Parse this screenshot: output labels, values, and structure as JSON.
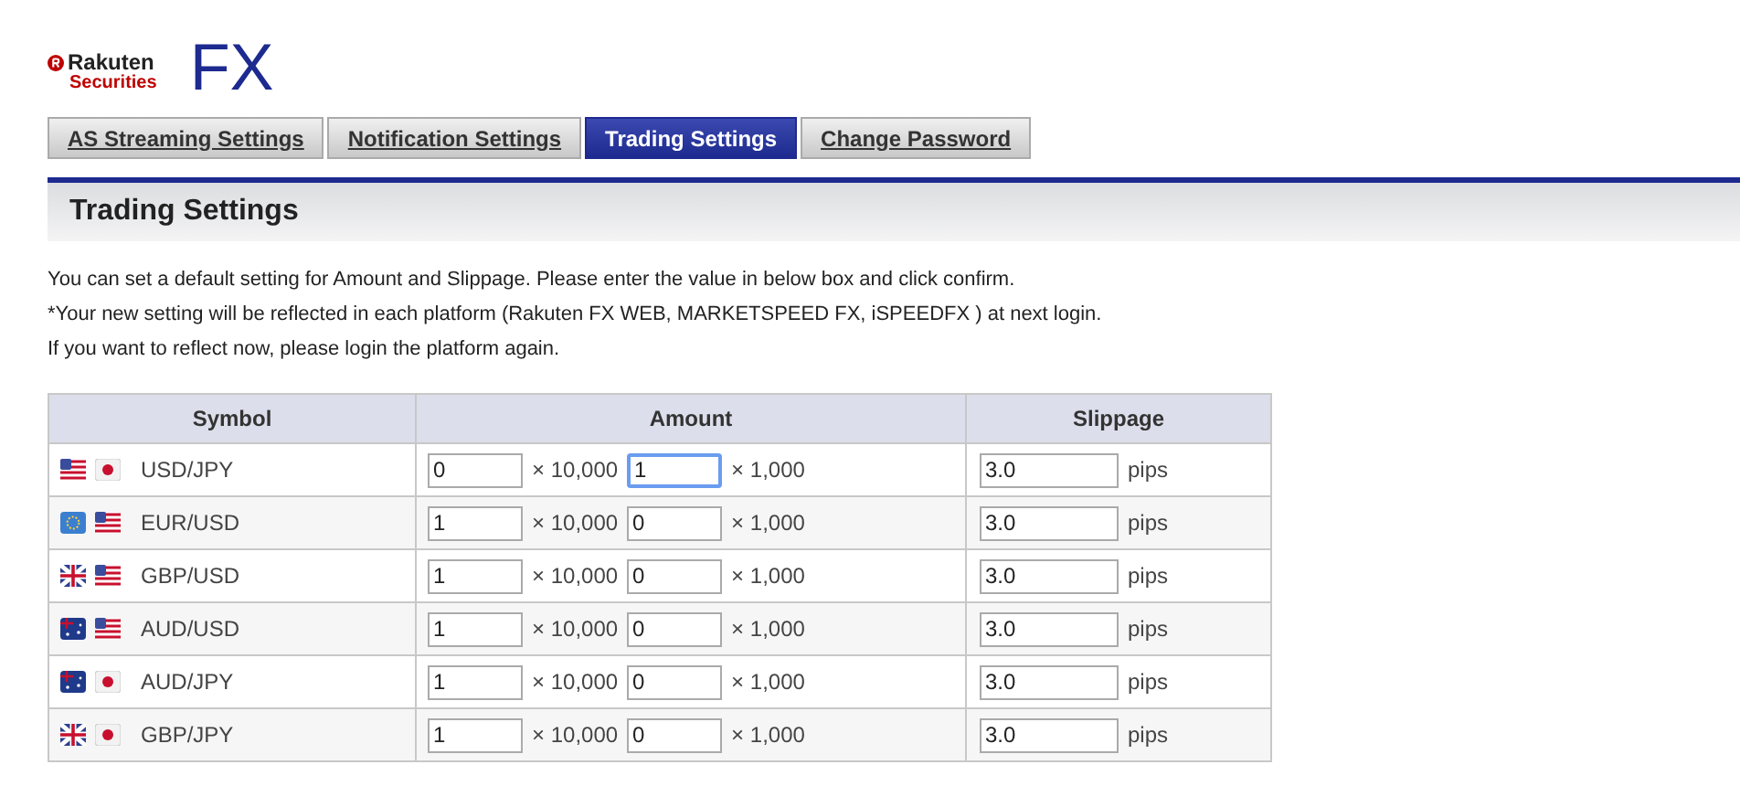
{
  "logo": {
    "line_1": "Rakuten",
    "line_2": "Securities"
  },
  "product": "FX",
  "tabs": [
    {
      "label": "AS Streaming Settings",
      "selected": false
    },
    {
      "label": "Notification Settings",
      "selected": false
    },
    {
      "label": "Trading Settings",
      "selected": true
    },
    {
      "label": "Change Password",
      "selected": false
    }
  ],
  "section_title": "Trading Settings",
  "intro": [
    "You can set a default setting for Amount and Slippage. Please enter the value in below box and click confirm.",
    "*Your new setting will be reflected in each platform (Rakuten FX WEB, MARKETSPEED FX, iSPEEDFX ) at next login.",
    "If you want to reflect now, please login the platform again."
  ],
  "table": {
    "columns": [
      "Symbol",
      "Amount",
      "Slippage"
    ],
    "rows": [
      {
        "flags": [
          {
            "kind": "us"
          },
          {
            "kind": "jp"
          }
        ],
        "symbol": "USD/JPY",
        "amount_10000": {
          "value": "0",
          "focused": false
        },
        "unit_10000": "× 10,000",
        "amount_1000": {
          "value": "1",
          "focused": true
        },
        "unit_1000": "× 1,000",
        "slippage": {
          "value": "3.0",
          "focused": false
        },
        "unit_slippage": "pips"
      },
      {
        "flags": [
          {
            "kind": "eu"
          },
          {
            "kind": "us"
          }
        ],
        "symbol": "EUR/USD",
        "amount_10000": {
          "value": "1",
          "focused": false
        },
        "unit_10000": "× 10,000",
        "amount_1000": {
          "value": "0",
          "focused": false
        },
        "unit_1000": "× 1,000",
        "slippage": {
          "value": "3.0",
          "focused": false
        },
        "unit_slippage": "pips"
      },
      {
        "flags": [
          {
            "kind": "gb"
          },
          {
            "kind": "us"
          }
        ],
        "symbol": "GBP/USD",
        "amount_10000": {
          "value": "1",
          "focused": false
        },
        "unit_10000": "× 10,000",
        "amount_1000": {
          "value": "0",
          "focused": false
        },
        "unit_1000": "× 1,000",
        "slippage": {
          "value": "3.0",
          "focused": false
        },
        "unit_slippage": "pips"
      },
      {
        "flags": [
          {
            "kind": "au"
          },
          {
            "kind": "us"
          }
        ],
        "symbol": "AUD/USD",
        "amount_10000": {
          "value": "1",
          "focused": false
        },
        "unit_10000": "× 10,000",
        "amount_1000": {
          "value": "0",
          "focused": false
        },
        "unit_1000": "× 1,000",
        "slippage": {
          "value": "3.0",
          "focused": false
        },
        "unit_slippage": "pips"
      },
      {
        "flags": [
          {
            "kind": "au"
          },
          {
            "kind": "jp"
          }
        ],
        "symbol": "AUD/JPY",
        "amount_10000": {
          "value": "1",
          "focused": false
        },
        "unit_10000": "× 10,000",
        "amount_1000": {
          "value": "0",
          "focused": false
        },
        "unit_1000": "× 1,000",
        "slippage": {
          "value": "3.0",
          "focused": false
        },
        "unit_slippage": "pips"
      },
      {
        "flags": [
          {
            "kind": "gb"
          },
          {
            "kind": "jp"
          }
        ],
        "symbol": "GBP/JPY",
        "amount_10000": {
          "value": "1",
          "focused": false
        },
        "unit_10000": "× 10,000",
        "amount_1000": {
          "value": "0",
          "focused": false
        },
        "unit_1000": "× 1,000",
        "slippage": {
          "value": "3.0",
          "focused": false
        },
        "unit_slippage": "pips"
      }
    ]
  }
}
